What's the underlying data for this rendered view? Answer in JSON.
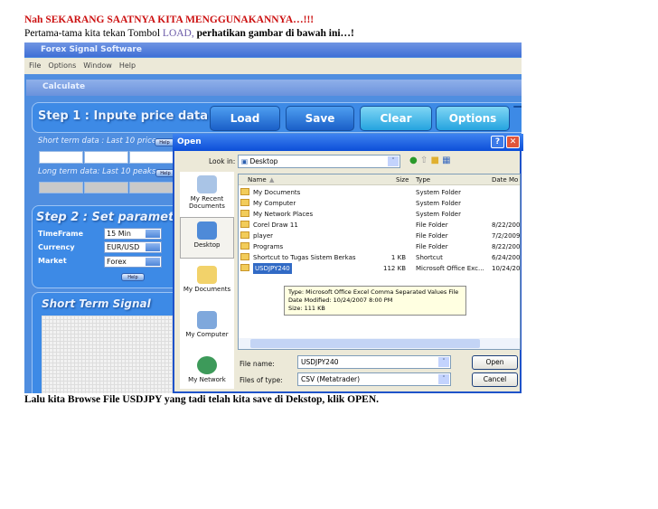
{
  "doc": {
    "heading": "Nah SEKARANG SAATNYA KITA MENGGUNAKANNYA…!!!",
    "intro_a": "Pertama-tama kita tekan Tombol ",
    "intro_load": "LOAD,",
    "intro_b": " perhatikan gambar di bawah ini…!",
    "caption": "Lalu kita Browse File USDJPY yang  tadi telah kita save di Dekstop, klik OPEN.",
    "colors": {
      "heading": "#cc1111",
      "load": "#6b5aa8"
    }
  },
  "app": {
    "title": "Forex Signal Software",
    "menu": [
      "File",
      "Options",
      "Window",
      "Help"
    ],
    "child_title": "Calculate",
    "step1": "Step 1 : Inpute price data",
    "buttons": [
      "Load",
      "Save",
      "Clear",
      "Options"
    ],
    "short_label": "Short term data : Last 10 prices",
    "long_label": "Long term data: Last 10 peaks",
    "help": "Help",
    "step2": "Step 2 : Set parameter",
    "params": [
      {
        "label": "TimeFrame",
        "value": "15 Min"
      },
      {
        "label": "Currency",
        "value": "EUR/USD"
      },
      {
        "label": "Market",
        "value": "Forex"
      }
    ],
    "signal": "Short Term Signal"
  },
  "dialog": {
    "title": "Open",
    "help_btn": "?",
    "close_btn": "✕",
    "look_in_label": "Look in:",
    "look_in": "Desktop",
    "places": [
      "My Recent Documents",
      "Desktop",
      "My Documents",
      "My Computer",
      "My Network"
    ],
    "columns": [
      "Name",
      "Size",
      "Type",
      "Date Mo"
    ],
    "files": [
      {
        "name": "My Documents",
        "size": "",
        "type": "System Folder",
        "date": ""
      },
      {
        "name": "My Computer",
        "size": "",
        "type": "System Folder",
        "date": ""
      },
      {
        "name": "My Network Places",
        "size": "",
        "type": "System Folder",
        "date": ""
      },
      {
        "name": "Corel Draw 11",
        "size": "",
        "type": "File Folder",
        "date": "8/22/200"
      },
      {
        "name": "player",
        "size": "",
        "type": "File Folder",
        "date": "7/2/2009"
      },
      {
        "name": "Programs",
        "size": "",
        "type": "File Folder",
        "date": "8/22/200"
      },
      {
        "name": "Shortcut to Tugas Sistem Berkas",
        "size": "1 KB",
        "type": "Shortcut",
        "date": "6/24/200"
      },
      {
        "name": "USDJPY240",
        "size": "112 KB",
        "type": "Microsoft Office Exc...",
        "date": "10/24/20"
      }
    ],
    "selected_index": 7,
    "tooltip": [
      "Type: Microsoft Office Excel Comma Separated Values File",
      "Date Modified: 10/24/2007 8:00 PM",
      "Size: 111 KB"
    ],
    "file_name_label": "File name:",
    "file_name": "USDJPY240",
    "file_type_label": "Files of type:",
    "file_type": "CSV (Metatrader)",
    "open": "Open",
    "cancel": "Cancel"
  }
}
